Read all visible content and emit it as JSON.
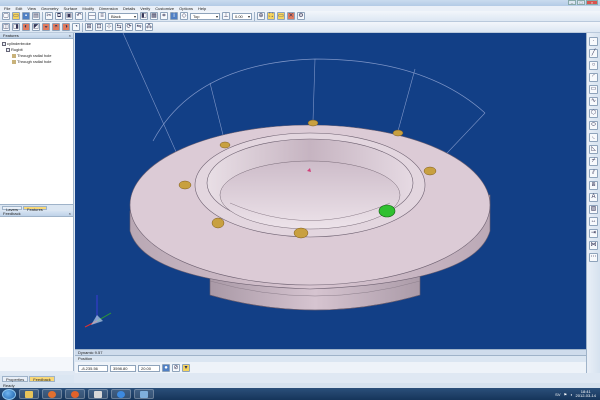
{
  "titlebar": {
    "controls": {
      "minimize": "–",
      "maximize": "□",
      "close": "×"
    }
  },
  "menu": [
    "File",
    "Edit",
    "View",
    "Geometry",
    "Surface",
    "Modify",
    "Dimension",
    "Details",
    "Verify",
    "Customize",
    "Options",
    "Help"
  ],
  "toolbar": {
    "combo_style": "Black",
    "combo_view": "Top",
    "combo_scale": "0.00"
  },
  "features_panel": {
    "title": "Features",
    "tree": [
      {
        "label": "cylinderbroke",
        "level": 0
      },
      {
        "label": "Rugbit",
        "level": 1
      },
      {
        "label": "Through radial hole",
        "level": 2
      },
      {
        "label": "Through radial hole",
        "level": 2
      }
    ],
    "tabs": [
      "Layers",
      "Features"
    ],
    "active_tab": "Features"
  },
  "feedback_panel": {
    "title": "Feedback"
  },
  "bottom_tabs": [
    "Properties",
    "Feedback"
  ],
  "viewport": {
    "dynamic_label": "Dynamic 9.57",
    "background": "#123f86",
    "part_color": "#d8c3cf",
    "highlight_color": "#30c030"
  },
  "command": {
    "label": "Position",
    "x": "-8.235.56",
    "y": "3598.80",
    "z": "20.00"
  },
  "statusbar": {
    "text": "Ready"
  },
  "taskbar": {
    "clock_time": "18:41",
    "clock_date": "2012-03-14",
    "lang": "SV"
  }
}
